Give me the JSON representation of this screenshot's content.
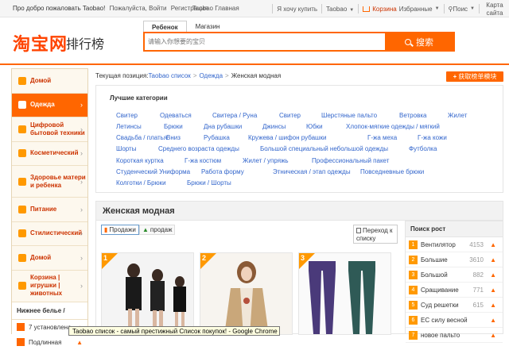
{
  "topbar": {
    "welcome": "Про добро пожаловать Taobao!",
    "login": "Пожалуйста, Войти",
    "register": "Регистрация",
    "overlap": "Taobao Главная",
    "buy": "Я хочу купить",
    "taobao": "Taobao",
    "cart": "Корзина",
    "favorites": "Избранные",
    "search": "Поис",
    "map": "Карта сайта"
  },
  "header": {
    "logo": "淘宝网",
    "logo_sub": "排行榜",
    "tabs": [
      "Ребенок",
      "Магазин"
    ],
    "search_placeholder": "请输入你想要的宝贝",
    "search_button": "搜索"
  },
  "sidebar": {
    "items": [
      {
        "label": "Домой"
      },
      {
        "label": "Одежда"
      },
      {
        "label": "Цифровой бытовой техники"
      },
      {
        "label": "Косметический"
      },
      {
        "label": "Здоровье матери и ребенка"
      },
      {
        "label": "Питание"
      },
      {
        "label": "Стилистический"
      },
      {
        "label": "Домой"
      },
      {
        "label": "Корзина | игрушки | животных"
      }
    ],
    "list_title": "Нижнее белье /",
    "list": [
      {
        "label": "7 установлена"
      },
      {
        "label": "Подлинная"
      }
    ]
  },
  "breadcrumb": {
    "prefix": "Текущая позиция:",
    "items": [
      "Taobao список",
      "Одежда",
      "Женская модная"
    ],
    "button": "获取榜单模块"
  },
  "categories": {
    "title": "Лучшие категории",
    "rows": [
      [
        "Свитер",
        "Одеваться",
        "Свитера / Руна",
        "Свитер",
        "Шерстяные пальто",
        "Ветровка",
        "Жилет"
      ],
      [
        "Летинсы",
        "Брюки",
        "Дна рубашки",
        "Джинсы",
        "Юбки",
        "Хлопок-мягкие одежды / мягкий"
      ],
      [
        "Свадьба / платья",
        "Вниз",
        "Рубашка",
        "Кружева / шифон рубашки",
        "Г-жа меха",
        "Г-жа кожи"
      ],
      [
        "Шорты",
        "Среднего возраста одежды",
        "Большой специальный небольшой одежды",
        "Футболка"
      ],
      [
        "Короткая куртка",
        "Г-жа костюм",
        "Жилет / упряжь",
        "Профессиональный пакет"
      ],
      [
        "Студенческий Униформа",
        "Работа форму",
        "Этническая / этап одежды",
        "Повседневные брюки"
      ],
      [
        "Колготки / Брюки",
        "Брюки / Шорты"
      ]
    ]
  },
  "section": {
    "title": "Женская модная",
    "sort_sales": "Продажи",
    "sort_sell": "продаж",
    "page_button": "Переход к списку",
    "products": [
      "1",
      "2",
      "3"
    ]
  },
  "rank": {
    "title": "Поиск рост",
    "items": [
      {
        "n": "1",
        "name": "Вентилятор",
        "value": "4153"
      },
      {
        "n": "2",
        "name": "Большие",
        "value": "3610"
      },
      {
        "n": "3",
        "name": "Большой",
        "value": "882"
      },
      {
        "n": "4",
        "name": "Сращивание",
        "value": "771"
      },
      {
        "n": "5",
        "name": "Суд решетки",
        "value": "615"
      },
      {
        "n": "6",
        "name": "ЕС силу весной",
        "value": ""
      },
      {
        "n": "7",
        "name": "новое пальто",
        "value": ""
      }
    ]
  },
  "tooltip": "Taobao список - самый престижный Список покупок! - Google Chrome",
  "colors": {
    "accent": "#ff6600",
    "link": "#3366cc"
  }
}
